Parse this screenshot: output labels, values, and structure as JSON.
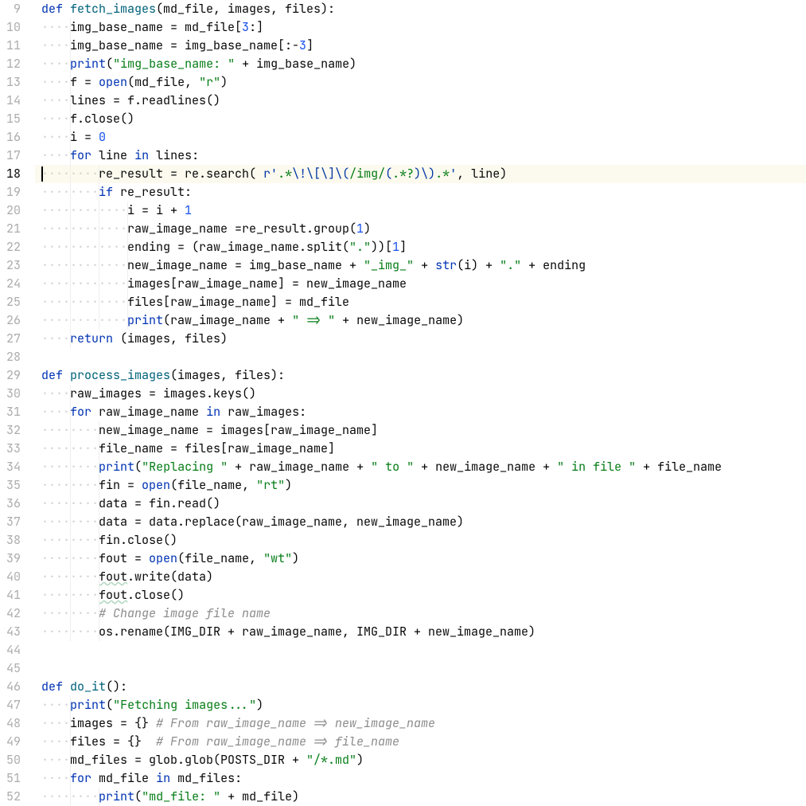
{
  "first_line_number": 9,
  "current_line_number": 18,
  "indent_guides_at_cols": [
    4,
    8,
    12,
    16
  ],
  "lines": [
    {
      "n": 9,
      "indent": 0,
      "tokens": [
        {
          "t": "def ",
          "c": "kw"
        },
        {
          "t": "fetch_images",
          "c": "def"
        },
        {
          "t": "(md_file, images, files):"
        }
      ]
    },
    {
      "n": 10,
      "indent": 4,
      "tokens": [
        {
          "t": "img_base_name = md_file["
        },
        {
          "t": "3",
          "c": "num"
        },
        {
          "t": ":]"
        }
      ]
    },
    {
      "n": 11,
      "indent": 4,
      "tokens": [
        {
          "t": "img_base_name = img_base_name[:-"
        },
        {
          "t": "3",
          "c": "num"
        },
        {
          "t": "]"
        }
      ]
    },
    {
      "n": 12,
      "indent": 4,
      "tokens": [
        {
          "t": "print",
          "c": "bname"
        },
        {
          "t": "("
        },
        {
          "t": "\"img_base_name: \"",
          "c": "str"
        },
        {
          "t": " + img_base_name)"
        }
      ]
    },
    {
      "n": 13,
      "indent": 4,
      "tokens": [
        {
          "t": "f = "
        },
        {
          "t": "open",
          "c": "bname"
        },
        {
          "t": "(md_file, "
        },
        {
          "t": "\"r\"",
          "c": "str"
        },
        {
          "t": ")"
        }
      ]
    },
    {
      "n": 14,
      "indent": 4,
      "tokens": [
        {
          "t": "lines = f.readlines()"
        }
      ]
    },
    {
      "n": 15,
      "indent": 4,
      "tokens": [
        {
          "t": "f.close()"
        }
      ]
    },
    {
      "n": 16,
      "indent": 4,
      "tokens": [
        {
          "t": "i = "
        },
        {
          "t": "0",
          "c": "num"
        }
      ]
    },
    {
      "n": 17,
      "indent": 4,
      "tokens": [
        {
          "t": "for ",
          "c": "kw"
        },
        {
          "t": "line "
        },
        {
          "t": "in ",
          "c": "kw"
        },
        {
          "t": "lines:"
        }
      ]
    },
    {
      "n": 18,
      "indent": 8,
      "current": true,
      "tokens": [
        {
          "t": "re_result = re.search( "
        },
        {
          "t": "r'",
          "c": "fmt"
        },
        {
          "t": ".*",
          "c": "str"
        },
        {
          "t": "\\!\\[\\]\\(",
          "c": "esc"
        },
        {
          "t": "/img/",
          "c": "str"
        },
        {
          "t": "(",
          "c": "esc"
        },
        {
          "t": ".*?",
          "c": "str"
        },
        {
          "t": ")",
          "c": "esc"
        },
        {
          "t": "\\)",
          "c": "esc"
        },
        {
          "t": ".*",
          "c": "str"
        },
        {
          "t": "'",
          "c": "fmt"
        },
        {
          "t": ", line)"
        }
      ]
    },
    {
      "n": 19,
      "indent": 8,
      "tokens": [
        {
          "t": "if ",
          "c": "kw"
        },
        {
          "t": "re_result:"
        }
      ]
    },
    {
      "n": 20,
      "indent": 12,
      "tokens": [
        {
          "t": "i = i + "
        },
        {
          "t": "1",
          "c": "num"
        }
      ]
    },
    {
      "n": 21,
      "indent": 12,
      "tokens": [
        {
          "t": "raw_image_name =re_result.group("
        },
        {
          "t": "1",
          "c": "num"
        },
        {
          "t": ")"
        }
      ]
    },
    {
      "n": 22,
      "indent": 12,
      "tokens": [
        {
          "t": "ending = (raw_image_name.split("
        },
        {
          "t": "\".\"",
          "c": "str"
        },
        {
          "t": "))["
        },
        {
          "t": "1",
          "c": "num"
        },
        {
          "t": "]"
        }
      ]
    },
    {
      "n": 23,
      "indent": 12,
      "tokens": [
        {
          "t": "new_image_name = img_base_name + "
        },
        {
          "t": "\"_img_\"",
          "c": "str"
        },
        {
          "t": " + "
        },
        {
          "t": "str",
          "c": "bname"
        },
        {
          "t": "(i) + "
        },
        {
          "t": "\".\"",
          "c": "str"
        },
        {
          "t": " + ending"
        }
      ]
    },
    {
      "n": 24,
      "indent": 12,
      "tokens": [
        {
          "t": "images[raw_image_name] = new_image_name"
        }
      ]
    },
    {
      "n": 25,
      "indent": 12,
      "tokens": [
        {
          "t": "files[raw_image_name] = md_file"
        }
      ]
    },
    {
      "n": 26,
      "indent": 12,
      "tokens": [
        {
          "t": "print",
          "c": "bname"
        },
        {
          "t": "(raw_image_name + "
        },
        {
          "t": "\" => \"",
          "c": "str"
        },
        {
          "t": " + new_image_name)"
        }
      ]
    },
    {
      "n": 27,
      "indent": 4,
      "tokens": [
        {
          "t": "return ",
          "c": "kw"
        },
        {
          "t": "(images, files)"
        }
      ]
    },
    {
      "n": 28,
      "indent": 0,
      "tokens": []
    },
    {
      "n": 29,
      "indent": 0,
      "tokens": [
        {
          "t": "def ",
          "c": "kw"
        },
        {
          "t": "process_images",
          "c": "def"
        },
        {
          "t": "(images, files):"
        }
      ]
    },
    {
      "n": 30,
      "indent": 4,
      "tokens": [
        {
          "t": "raw_images = images.keys()"
        }
      ]
    },
    {
      "n": 31,
      "indent": 4,
      "tokens": [
        {
          "t": "for ",
          "c": "kw"
        },
        {
          "t": "raw_image_name "
        },
        {
          "t": "in ",
          "c": "kw"
        },
        {
          "t": "raw_images:"
        }
      ]
    },
    {
      "n": 32,
      "indent": 8,
      "tokens": [
        {
          "t": "new_image_name = images[raw_image_name]"
        }
      ]
    },
    {
      "n": 33,
      "indent": 8,
      "tokens": [
        {
          "t": "file_name = files[raw_image_name]"
        }
      ]
    },
    {
      "n": 34,
      "indent": 8,
      "tokens": [
        {
          "t": "print",
          "c": "bname"
        },
        {
          "t": "("
        },
        {
          "t": "\"Replacing \"",
          "c": "str"
        },
        {
          "t": " + raw_image_name + "
        },
        {
          "t": "\" to \"",
          "c": "str"
        },
        {
          "t": " + new_image_name + "
        },
        {
          "t": "\" in file \"",
          "c": "str"
        },
        {
          "t": " + file_name"
        }
      ]
    },
    {
      "n": 35,
      "indent": 8,
      "tokens": [
        {
          "t": "fin = "
        },
        {
          "t": "open",
          "c": "bname"
        },
        {
          "t": "(file_name, "
        },
        {
          "t": "\"rt\"",
          "c": "str"
        },
        {
          "t": ")"
        }
      ]
    },
    {
      "n": 36,
      "indent": 8,
      "tokens": [
        {
          "t": "data = fin.read()"
        }
      ]
    },
    {
      "n": 37,
      "indent": 8,
      "tokens": [
        {
          "t": "data = data.replace(raw_image_name, new_image_name)"
        }
      ]
    },
    {
      "n": 38,
      "indent": 8,
      "tokens": [
        {
          "t": "fin.close()"
        }
      ]
    },
    {
      "n": 39,
      "indent": 8,
      "tokens": [
        {
          "t": "fout = "
        },
        {
          "t": "open",
          "c": "bname"
        },
        {
          "t": "(file_name, "
        },
        {
          "t": "\"wt\"",
          "c": "str"
        },
        {
          "t": ")"
        }
      ]
    },
    {
      "n": 40,
      "indent": 8,
      "tokens": [
        {
          "t": "fout",
          "c": "wavy"
        },
        {
          "t": ".write(data)"
        }
      ]
    },
    {
      "n": 41,
      "indent": 8,
      "tokens": [
        {
          "t": "fout",
          "c": "wavy"
        },
        {
          "t": ".close()"
        }
      ]
    },
    {
      "n": 42,
      "indent": 8,
      "tokens": [
        {
          "t": "# Change image file name",
          "c": "cmt"
        }
      ]
    },
    {
      "n": 43,
      "indent": 8,
      "tokens": [
        {
          "t": "os.rename(IMG_DIR + raw_image_name, IMG_DIR + new_image_name)"
        }
      ]
    },
    {
      "n": 44,
      "indent": 0,
      "tokens": []
    },
    {
      "n": 45,
      "indent": 0,
      "tokens": []
    },
    {
      "n": 46,
      "indent": 0,
      "tokens": [
        {
          "t": "def ",
          "c": "kw"
        },
        {
          "t": "do_it",
          "c": "def"
        },
        {
          "t": "():"
        }
      ]
    },
    {
      "n": 47,
      "indent": 4,
      "tokens": [
        {
          "t": "print",
          "c": "bname"
        },
        {
          "t": "("
        },
        {
          "t": "\"Fetching images...\"",
          "c": "str"
        },
        {
          "t": ")"
        }
      ]
    },
    {
      "n": 48,
      "indent": 4,
      "tokens": [
        {
          "t": "images = {} "
        },
        {
          "t": "# From raw_image_name => new_image_name",
          "c": "cmt"
        }
      ]
    },
    {
      "n": 49,
      "indent": 4,
      "tokens": [
        {
          "t": "files = {}  "
        },
        {
          "t": "# From raw_image_name => file_name",
          "c": "cmt"
        }
      ]
    },
    {
      "n": 50,
      "indent": 4,
      "tokens": [
        {
          "t": "md_files = glob.glob(POSTS_DIR + "
        },
        {
          "t": "\"/*.md\"",
          "c": "str"
        },
        {
          "t": ")"
        }
      ]
    },
    {
      "n": 51,
      "indent": 4,
      "tokens": [
        {
          "t": "for ",
          "c": "kw"
        },
        {
          "t": "md_file "
        },
        {
          "t": "in ",
          "c": "kw"
        },
        {
          "t": "md_files:"
        }
      ]
    },
    {
      "n": 52,
      "indent": 8,
      "tokens": [
        {
          "t": "print",
          "c": "bname"
        },
        {
          "t": "("
        },
        {
          "t": "\"md_file: \"",
          "c": "str"
        },
        {
          "t": " + md_file)"
        }
      ]
    }
  ]
}
